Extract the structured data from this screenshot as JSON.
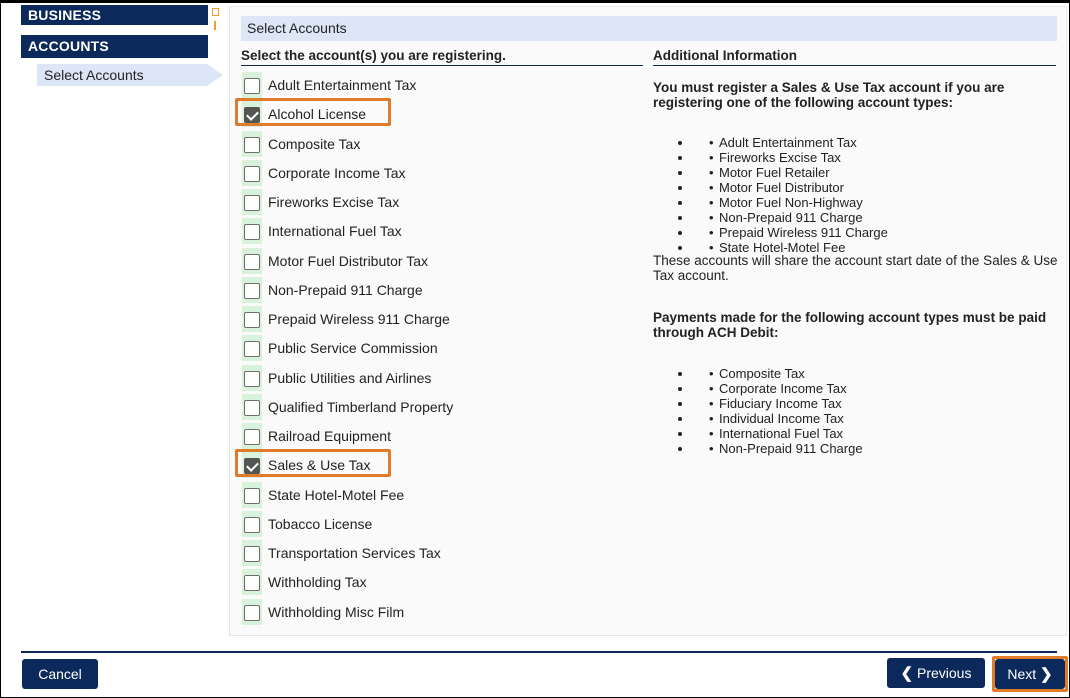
{
  "nav": {
    "business": "BUSINESS",
    "accounts": "ACCOUNTS",
    "select_accounts": "Select Accounts"
  },
  "panel": {
    "header": "Select Accounts",
    "left_heading": "Select the account(s) you are registering.",
    "right_heading": "Additional Information"
  },
  "accounts": [
    {
      "label": "Adult Entertainment Tax",
      "checked": false
    },
    {
      "label": "Alcohol License",
      "checked": true
    },
    {
      "label": "Composite Tax",
      "checked": false
    },
    {
      "label": "Corporate Income Tax",
      "checked": false
    },
    {
      "label": "Fireworks Excise Tax",
      "checked": false
    },
    {
      "label": "International Fuel Tax",
      "checked": false
    },
    {
      "label": "Motor Fuel Distributor Tax",
      "checked": false
    },
    {
      "label": "Non-Prepaid 911 Charge",
      "checked": false
    },
    {
      "label": "Prepaid Wireless 911 Charge",
      "checked": false
    },
    {
      "label": "Public Service Commission",
      "checked": false
    },
    {
      "label": "Public Utilities and Airlines",
      "checked": false
    },
    {
      "label": "Qualified Timberland Property",
      "checked": false
    },
    {
      "label": "Railroad Equipment",
      "checked": false
    },
    {
      "label": "Sales & Use Tax",
      "checked": true
    },
    {
      "label": "State Hotel-Motel Fee",
      "checked": false
    },
    {
      "label": "Tobacco License",
      "checked": false
    },
    {
      "label": "Transportation Services Tax",
      "checked": false
    },
    {
      "label": "Withholding Tax",
      "checked": false
    },
    {
      "label": "Withholding Misc Film",
      "checked": false
    }
  ],
  "info": {
    "sales_use_heading": "You must register a Sales & Use Tax account if you are registering one of the following account types:",
    "sales_use_list": [
      "Adult Entertainment Tax",
      "Fireworks Excise Tax",
      "Motor Fuel Retailer",
      "Motor Fuel Distributor",
      "Motor Fuel Non-Highway",
      "Non-Prepaid 911 Charge",
      "Prepaid Wireless 911 Charge",
      "State Hotel-Motel Fee"
    ],
    "share_note": "These accounts will share the account start date of the Sales & Use Tax account.",
    "ach_heading": "Payments made for the following account types must be paid through ACH Debit:",
    "ach_list": [
      "Composite Tax",
      "Corporate Income Tax",
      "Fiduciary Income Tax",
      "Individual Income Tax",
      "International Fuel Tax",
      "Non-Prepaid 911 Charge"
    ]
  },
  "footer": {
    "cancel": "Cancel",
    "previous": "Previous",
    "next": "Next"
  },
  "colors": {
    "navy": "#0b2a5b",
    "light_blue": "#dce6f7",
    "highlight_orange": "#e07b2a",
    "checkbox_strip": "#d9f2dc"
  }
}
